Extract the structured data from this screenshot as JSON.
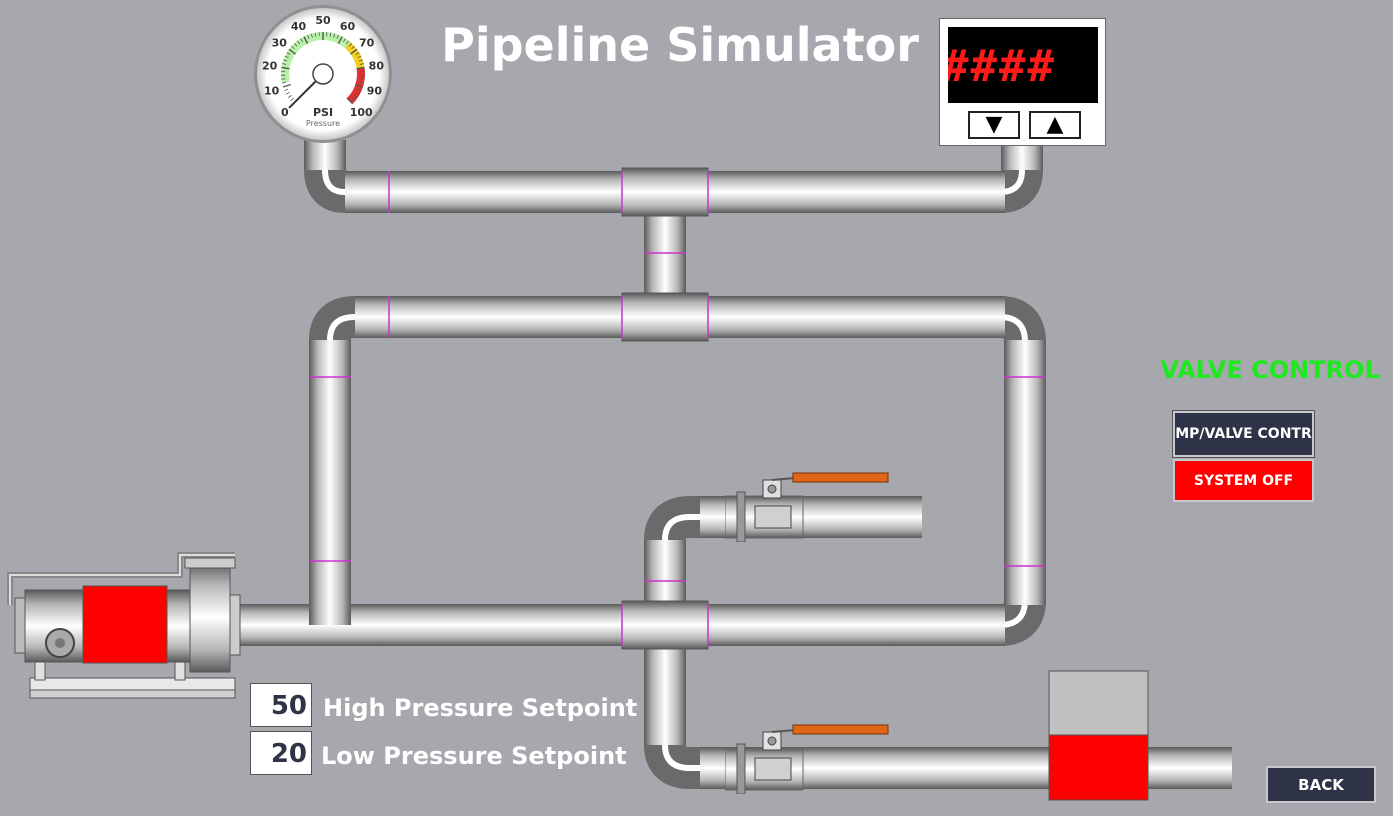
{
  "title": "Pipeline Simulator",
  "gauge": {
    "unit": "PSI",
    "label": "Pressure",
    "ticks": [
      "0",
      "10",
      "20",
      "30",
      "40",
      "50",
      "60",
      "70",
      "80",
      "90",
      "100"
    ],
    "value": 0
  },
  "digital_display": {
    "text": "####",
    "up_icon": "triangle-up-icon",
    "down_icon": "triangle-down-icon"
  },
  "valve_control": {
    "title": "VALVE CONTROL",
    "pump_valve_button": "MP/VALVE CONTR",
    "system_button": "SYSTEM OFF"
  },
  "setpoints": {
    "high": {
      "value": "50",
      "label": "High Pressure Setpoint"
    },
    "low": {
      "value": "20",
      "label": "Low Pressure Setpoint"
    }
  },
  "back_button": "BACK",
  "colors": {
    "background": "#a7a8ae",
    "title": "#ffffff",
    "valve_title": "#1ee81e",
    "pump_body": "#ff0000",
    "tank_fill": "#ff0000",
    "tank_empty": "#c0c0c0",
    "valve_handle": "#e0661a",
    "button_dark": "#2f3347",
    "button_red": "#ff0000",
    "display_text": "#ff1a1a"
  }
}
